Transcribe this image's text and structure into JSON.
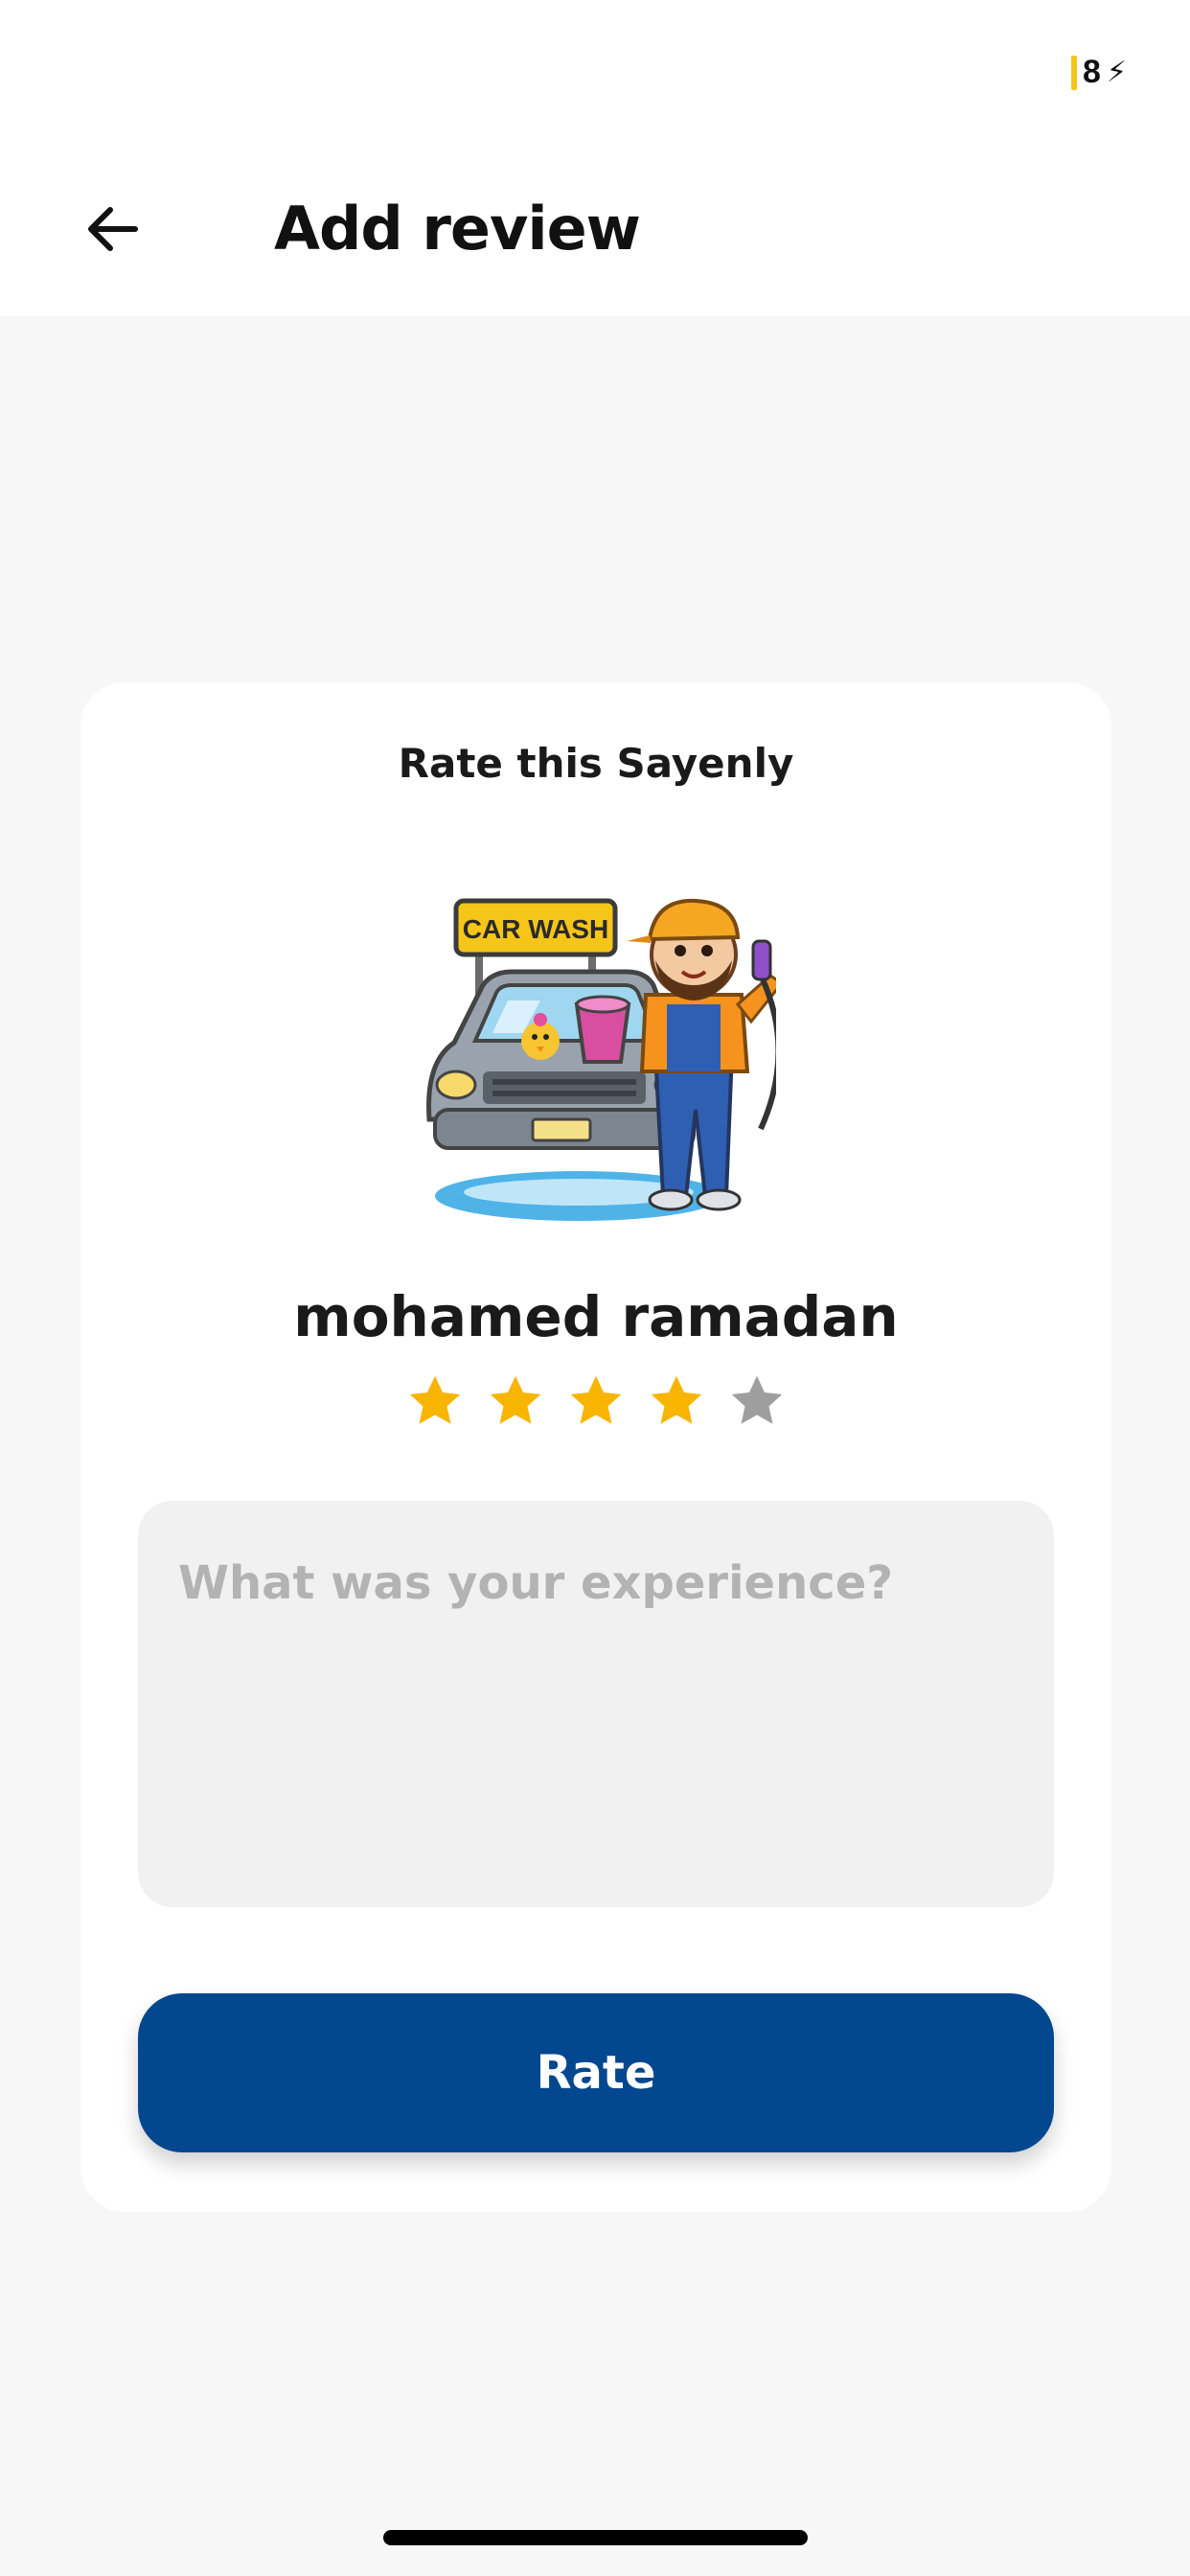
{
  "status_bar": {
    "battery_text": "8"
  },
  "header": {
    "title": "Add review",
    "back_icon": "arrow-left-icon"
  },
  "card": {
    "heading": "Rate this Sayenly",
    "avatar": {
      "sign_text": "CAR WASH"
    },
    "provider_name": "mohamed ramadan",
    "rating": {
      "value": 4,
      "max": 5,
      "filled_color": "#f7b500",
      "empty_color": "#9e9e9e"
    },
    "review": {
      "placeholder": "What was your experience?",
      "value": ""
    },
    "rate_button": {
      "label": "Rate",
      "color": "#03478f"
    }
  }
}
